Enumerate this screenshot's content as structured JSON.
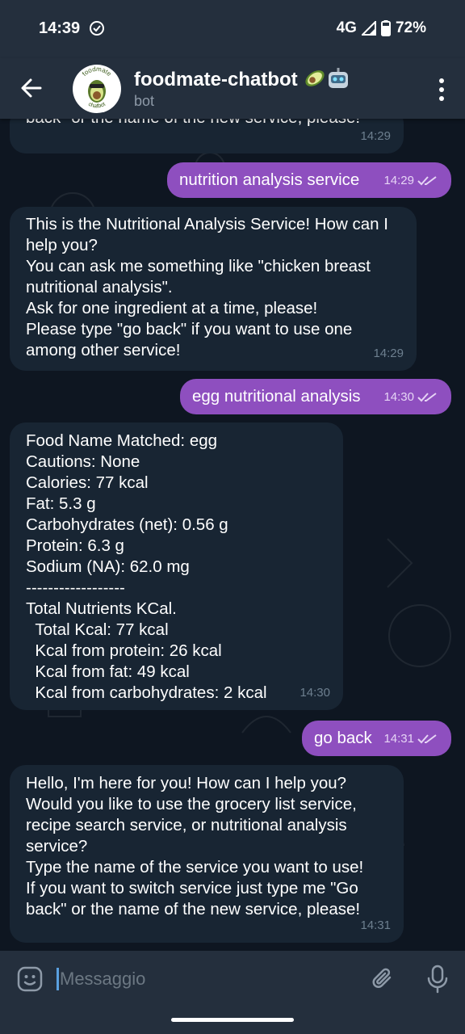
{
  "status_bar": {
    "time": "14:39",
    "network": "4G",
    "battery": "72%"
  },
  "header": {
    "title": "foodmate-chatbot",
    "subtitle": "bot",
    "avatar_text_top": "foodmate",
    "avatar_text_bottom": "chatbot",
    "back_icon": "arrow-left-icon",
    "menu_icon": "more-vertical-icon"
  },
  "messages": [
    {
      "dir": "in",
      "text": "back\" or the name of the new service, please!",
      "time": "14:29"
    },
    {
      "dir": "out",
      "text": "nutrition analysis service",
      "time": "14:29"
    },
    {
      "dir": "in",
      "text": "This is the Nutritional Analysis Service! How can I help you?\nYou can ask me something like \"chicken breast nutritional analysis\".\nAsk for one ingredient at a time, please!\nPlease type \"go back\" if you want to use one among other service!",
      "time": "14:29"
    },
    {
      "dir": "out",
      "text": "egg nutritional analysis",
      "time": "14:30"
    },
    {
      "dir": "in",
      "text": "Food Name Matched: egg\nCautions: None\nCalories: 77 kcal\nFat: 5.3 g\nCarbohydrates (net): 0.56 g\nProtein: 6.3 g\nSodium (NA): 62.0 mg\n------------------\nTotal Nutrients KCal.\n  Total Kcal: 77 kcal\n  Kcal from protein: 26 kcal\n  Kcal from fat: 49 kcal\n  Kcal from carbohydrates: 2 kcal",
      "time": "14:30"
    },
    {
      "dir": "out",
      "text": "go back",
      "time": "14:31"
    },
    {
      "dir": "in",
      "text": "Hello, I'm here for you! How can I help you?\nWould you like to use the grocery list service, recipe search service, or nutritional analysis service?\nType the name of the service you want to use!\nIf you want to switch service just type me \"Go back\" or the name of the new service, please!",
      "time": "14:31"
    }
  ],
  "input": {
    "placeholder": "Messaggio",
    "value": ""
  },
  "colors": {
    "background": "#0e1621",
    "header": "#242f3d",
    "incoming_bubble": "#182533",
    "outgoing_bubble": "#8e4fbf"
  }
}
